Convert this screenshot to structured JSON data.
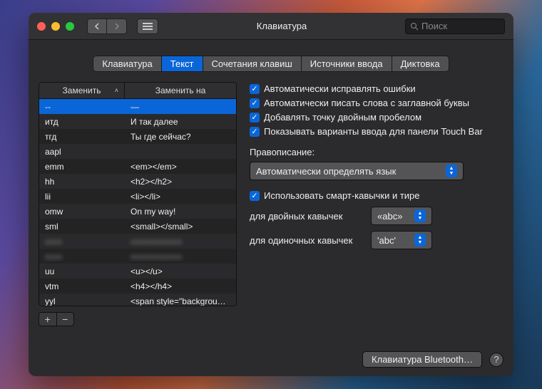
{
  "window": {
    "title": "Клавиатура"
  },
  "search": {
    "placeholder": "Поиск"
  },
  "tabs": [
    "Клавиатура",
    "Текст",
    "Сочетания клавиш",
    "Источники ввода",
    "Диктовка"
  ],
  "active_tab": 1,
  "table": {
    "headers": {
      "replace": "Заменить",
      "with": "Заменить на"
    },
    "rows": [
      {
        "replace": "--",
        "with": "—",
        "selected": true
      },
      {
        "replace": "итд",
        "with": "И так далее"
      },
      {
        "replace": "тгд",
        "with": "Ты где сейчас?"
      },
      {
        "replace": "aapl",
        "with": ""
      },
      {
        "replace": "emm",
        "with": "<em></em>"
      },
      {
        "replace": "hh",
        "with": "<h2></h2>"
      },
      {
        "replace": "lii",
        "with": "<li></li>"
      },
      {
        "replace": "omw",
        "with": "On my way!"
      },
      {
        "replace": "sml",
        "with": "<small></small>"
      },
      {
        "replace": "",
        "with": "",
        "blurred": true
      },
      {
        "replace": "",
        "with": "",
        "blurred": true
      },
      {
        "replace": "uu",
        "with": "<u></u>"
      },
      {
        "replace": "vtm",
        "with": "<h4></h4>"
      },
      {
        "replace": "yyl",
        "with": "<span style=\"background…"
      }
    ]
  },
  "checkboxes": {
    "auto_correct": "Автоматически исправлять ошибки",
    "auto_capitalize": "Автоматически писать слова с заглавной буквы",
    "double_space_period": "Добавлять точку двойным пробелом",
    "touch_bar_suggestions": "Показывать варианты ввода для панели Touch Bar",
    "smart_quotes": "Использовать смарт-кавычки и тире"
  },
  "spelling": {
    "label": "Правописание:",
    "value": "Автоматически определять язык"
  },
  "quotes": {
    "double_label": "для двойных кавычек",
    "double_value": "«abc»",
    "single_label": "для одиночных кавычек",
    "single_value": "'abc'"
  },
  "footer": {
    "bluetooth": "Клавиатура Bluetooth…",
    "help": "?"
  },
  "buttons": {
    "add": "+",
    "remove": "−"
  }
}
